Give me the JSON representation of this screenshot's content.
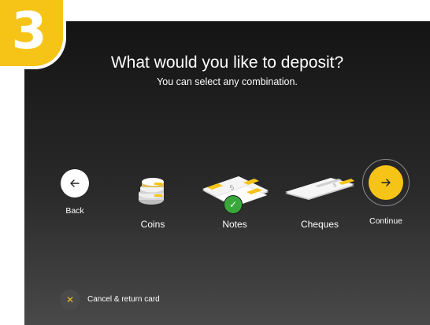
{
  "step": {
    "number": "3",
    "color": "#f5c417"
  },
  "header": {
    "title": "What would you like to deposit?",
    "subtitle": "You can select any combination."
  },
  "nav": {
    "back_label": "Back",
    "back_icon": "arrow-left-icon",
    "continue_label": "Continue",
    "continue_icon": "arrow-right-icon"
  },
  "options": [
    {
      "id": "coins",
      "label": "Coins",
      "icon": "coins-icon",
      "selected": false
    },
    {
      "id": "notes",
      "label": "Notes",
      "icon": "notes-icon",
      "selected": true
    },
    {
      "id": "cheques",
      "label": "Cheques",
      "icon": "cheques-icon",
      "selected": false
    }
  ],
  "footer": {
    "cancel_label": "Cancel & return card",
    "cancel_icon": "close-icon"
  },
  "colors": {
    "accent": "#f5c417",
    "selected": "#38a83a",
    "background": "#1e1d1d"
  }
}
